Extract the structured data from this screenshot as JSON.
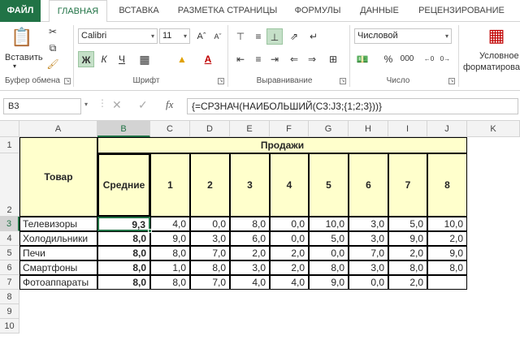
{
  "tabs": [
    "ФАЙЛ",
    "ГЛАВНАЯ",
    "ВСТАВКА",
    "РАЗМЕТКА СТРАНИЦЫ",
    "ФОРМУЛЫ",
    "ДАННЫЕ",
    "РЕЦЕНЗИРОВАНИЕ"
  ],
  "ribbon": {
    "paste_label": "Вставить",
    "clipboard_label": "Буфер обмена",
    "font_label": "Шрифт",
    "alignment_label": "Выравнивание",
    "number_label": "Число",
    "font_name": "Calibri",
    "font_size": "11",
    "bold_btn": "Ж",
    "italic_btn": "К",
    "underline_btn": "Ч",
    "number_format": "Числовой",
    "cond_format_line1": "Условное",
    "cond_format_line2": "форматирован",
    "percent": "%",
    "thousands": "000"
  },
  "formula_bar": {
    "name_box": "B3",
    "fx": "fx",
    "formula": "{=СРЗНАЧ(НАИБОЛЬШИЙ(C3:J3;{1;2;3}))}"
  },
  "columns": [
    "A",
    "B",
    "C",
    "D",
    "E",
    "F",
    "G",
    "H",
    "I",
    "J",
    "K"
  ],
  "rows": [
    "1",
    "2",
    "3",
    "4",
    "5",
    "6",
    "7",
    "8",
    "9",
    "10"
  ],
  "table": {
    "header_product": "Товар",
    "header_sales": "Продажи",
    "header_avg": "Средние",
    "sale_numbers": [
      "1",
      "2",
      "3",
      "4",
      "5",
      "6",
      "7",
      "8"
    ],
    "data": [
      {
        "name": "Телевизоры",
        "avg": "9,3",
        "vals": [
          "4,0",
          "0,0",
          "8,0",
          "0,0",
          "10,0",
          "3,0",
          "5,0",
          "10,0"
        ]
      },
      {
        "name": "Холодильники",
        "avg": "8,0",
        "vals": [
          "9,0",
          "3,0",
          "6,0",
          "0,0",
          "5,0",
          "3,0",
          "9,0",
          "2,0"
        ]
      },
      {
        "name": "Печи",
        "avg": "8,0",
        "vals": [
          "8,0",
          "7,0",
          "2,0",
          "2,0",
          "0,0",
          "7,0",
          "2,0",
          "9,0"
        ]
      },
      {
        "name": "Смартфоны",
        "avg": "8,0",
        "vals": [
          "1,0",
          "8,0",
          "3,0",
          "2,0",
          "8,0",
          "3,0",
          "8,0",
          "8,0"
        ]
      },
      {
        "name": "Фотоаппараты",
        "avg": "8,0",
        "vals": [
          "8,0",
          "7,0",
          "4,0",
          "4,0",
          "9,0",
          "0,0",
          "2,0"
        ]
      }
    ]
  }
}
